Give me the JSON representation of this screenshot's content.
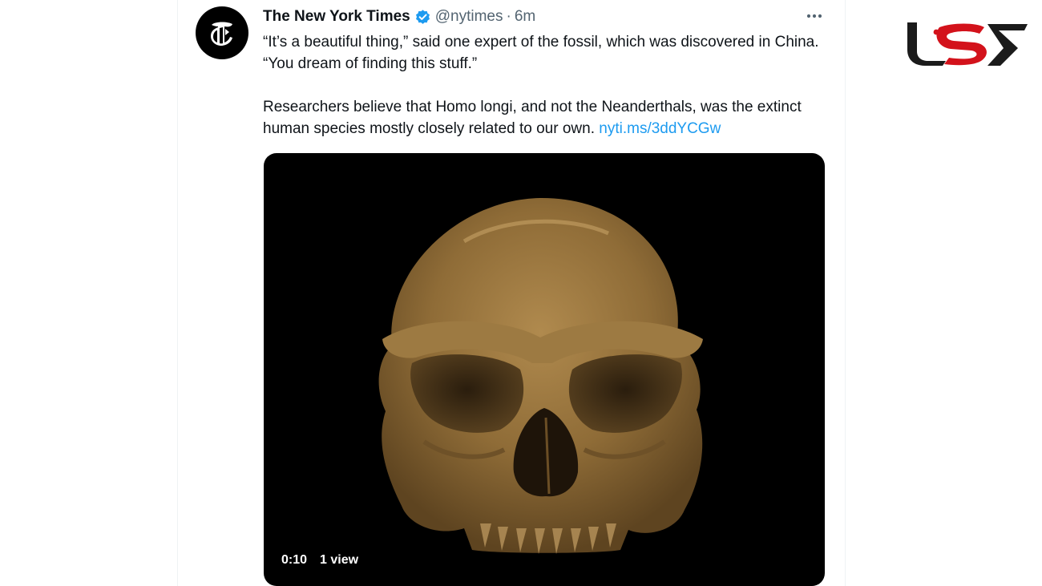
{
  "tweet": {
    "author": {
      "display_name": "The New York Times",
      "handle": "@nytimes",
      "verified": true,
      "avatar_icon": "nyt-t-logo-icon"
    },
    "separator": "·",
    "time": "6m",
    "paragraphs": [
      "“It’s a beautiful thing,” said one expert of the fossil, which was discovered in China. “You dream of finding this stuff.”",
      "Researchers believe that Homo longi, and not the Neanderthals, was the extinct human species mostly closely related to our own."
    ],
    "link_text": "nyti.ms/3ddYCGw",
    "more_icon": "more-dots-icon",
    "media": {
      "type": "video",
      "content": "skull-fossil-icon",
      "duration": "0:10",
      "views": "1 view"
    }
  },
  "site_logo": {
    "icon": "site-logo-icon"
  },
  "colors": {
    "text_primary": "#0f1419",
    "text_secondary": "#536471",
    "link": "#1d9bf0",
    "verified": "#1d9bf0",
    "logo_red": "#d3121b",
    "logo_dark": "#1b1b1b",
    "skull": "#8a6a36"
  }
}
